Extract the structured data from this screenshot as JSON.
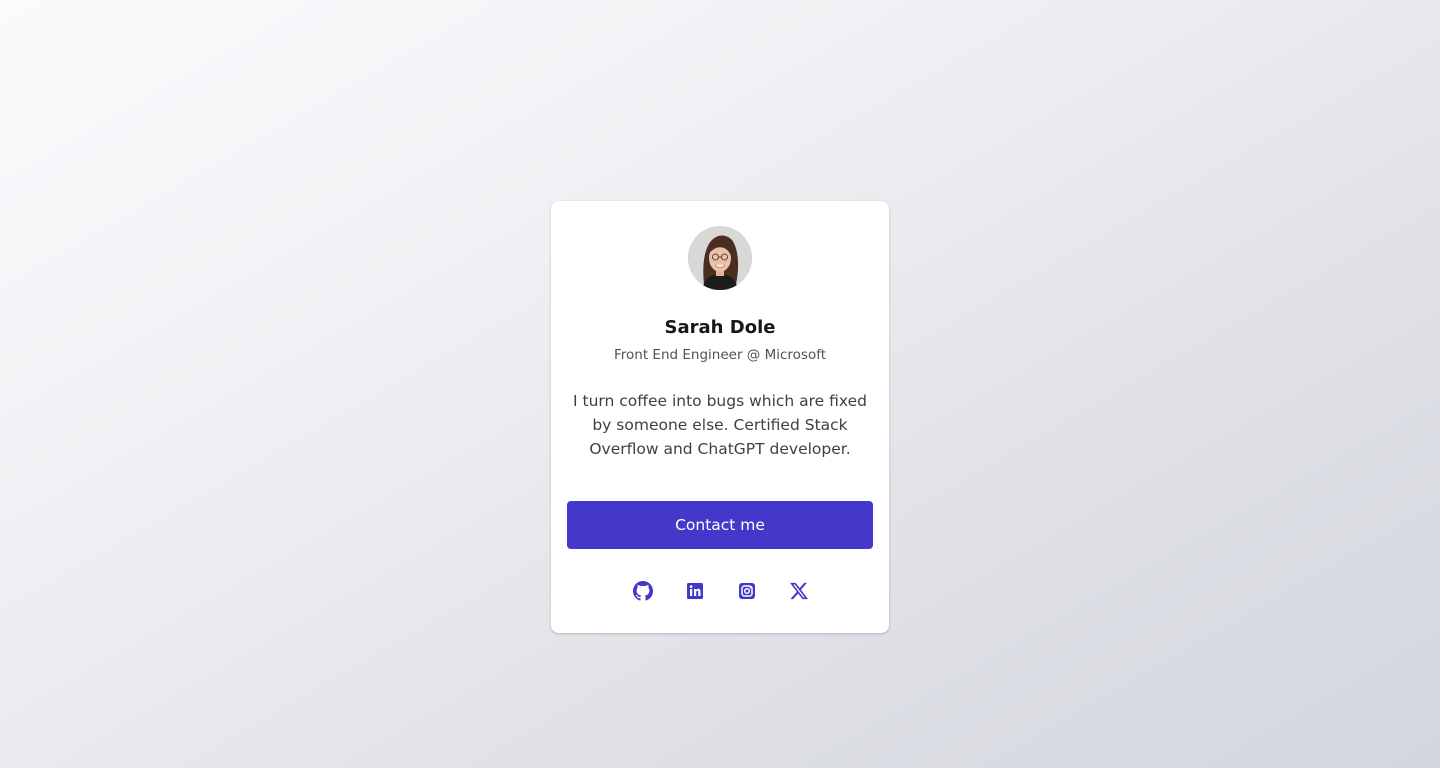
{
  "profile": {
    "name": "Sarah Dole",
    "title": "Front End Engineer @ Microsoft",
    "bio": "I turn coffee into bugs which are fixed by someone else. Certified Stack Overflow and ChatGPT developer.",
    "avatar_alt": "Sarah Dole"
  },
  "actions": {
    "contact_label": "Contact me"
  },
  "socials": [
    {
      "icon": "github-icon",
      "label": "GitHub"
    },
    {
      "icon": "linkedin-icon",
      "label": "LinkedIn"
    },
    {
      "icon": "instagram-icon",
      "label": "Instagram"
    },
    {
      "icon": "x-icon",
      "label": "X"
    }
  ],
  "colors": {
    "accent": "#4338ca",
    "name_text": "#171717",
    "body_text": "#404040",
    "card_bg": "#ffffff"
  }
}
